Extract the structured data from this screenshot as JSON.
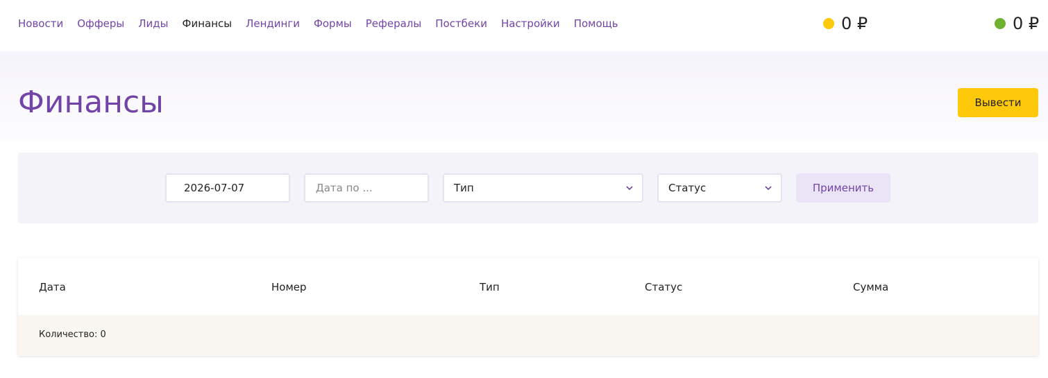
{
  "nav": {
    "items": [
      {
        "label": "Новости",
        "active": false
      },
      {
        "label": "Офферы",
        "active": false
      },
      {
        "label": "Лиды",
        "active": false
      },
      {
        "label": "Финансы",
        "active": true
      },
      {
        "label": "Лендинги",
        "active": false
      },
      {
        "label": "Формы",
        "active": false
      },
      {
        "label": "Рефералы",
        "active": false
      },
      {
        "label": "Постбеки",
        "active": false
      },
      {
        "label": "Настройки",
        "active": false
      },
      {
        "label": "Помощь",
        "active": false
      }
    ]
  },
  "balances": [
    {
      "value": "0 ₽",
      "color": "#fec80b"
    },
    {
      "value": "0 ₽",
      "color": "#6fb22d"
    }
  ],
  "page": {
    "title": "Финансы",
    "withdraw_label": "Вывести"
  },
  "filters": {
    "date_from_value": "2026-07-07",
    "date_to_placeholder": "Дата по ...",
    "type_selected": "Тип",
    "status_selected": "Статус",
    "apply_label": "Применить"
  },
  "table": {
    "columns": [
      "Дата",
      "Номер",
      "Тип",
      "Статус",
      "Сумма"
    ],
    "count_label": "Количество: 0"
  },
  "colors": {
    "accent": "#7244a8",
    "button_yellow": "#fec80b"
  }
}
